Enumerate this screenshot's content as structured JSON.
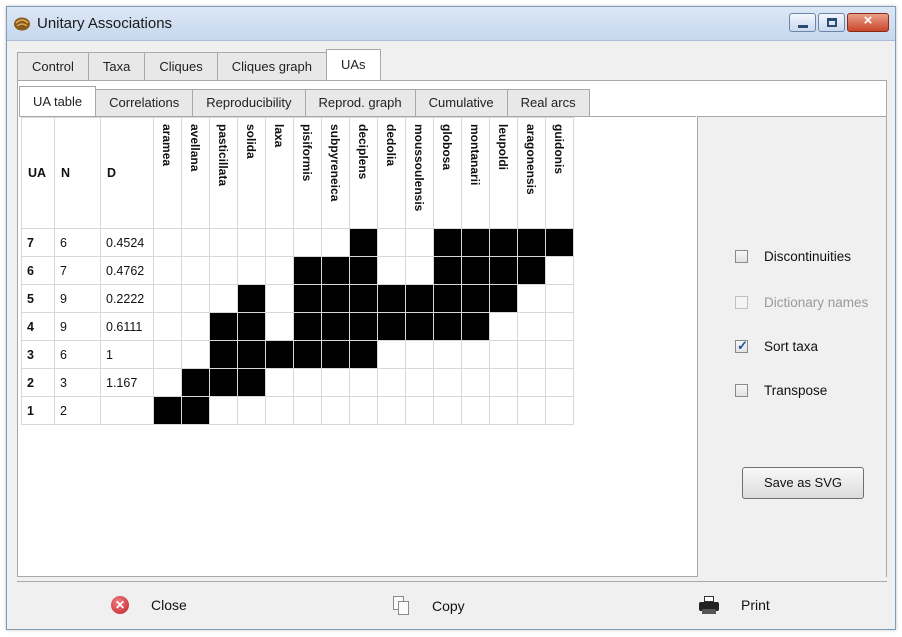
{
  "window": {
    "title": "Unitary Associations",
    "icon": "walnut-app-icon"
  },
  "tabs_main": [
    "Control",
    "Taxa",
    "Cliques",
    "Cliques graph",
    "UAs"
  ],
  "tabs_main_active": 4,
  "tabs_sub": [
    "UA table",
    "Correlations",
    "Reproducibility",
    "Reprod. graph",
    "Cumulative",
    "Real arcs"
  ],
  "tabs_sub_active": 0,
  "table": {
    "headers": {
      "ua": "UA",
      "n": "N",
      "d": "D"
    },
    "taxa": [
      "aramea",
      "avellana",
      "pasticillata",
      "solida",
      "laxa",
      "pisiformis",
      "subpyreneica",
      "deciplens",
      "dedolia",
      "moussoulensis",
      "globosa",
      "montanarii",
      "leupoldi",
      "aragonensis",
      "guidonis"
    ],
    "rows": [
      {
        "ua": "7",
        "n": "6",
        "d": "0.4524",
        "cells": [
          0,
          0,
          0,
          0,
          0,
          0,
          0,
          1,
          0,
          0,
          1,
          1,
          1,
          1,
          1
        ]
      },
      {
        "ua": "6",
        "n": "7",
        "d": "0.4762",
        "cells": [
          0,
          0,
          0,
          0,
          0,
          1,
          1,
          1,
          0,
          0,
          1,
          1,
          1,
          1,
          0
        ]
      },
      {
        "ua": "5",
        "n": "9",
        "d": "0.2222",
        "cells": [
          0,
          0,
          0,
          1,
          0,
          1,
          1,
          1,
          1,
          1,
          1,
          1,
          1,
          0,
          0
        ]
      },
      {
        "ua": "4",
        "n": "9",
        "d": "0.6111",
        "cells": [
          0,
          0,
          1,
          1,
          0,
          1,
          1,
          1,
          1,
          1,
          1,
          1,
          0,
          0,
          0
        ]
      },
      {
        "ua": "3",
        "n": "6",
        "d": "1",
        "cells": [
          0,
          0,
          1,
          1,
          1,
          1,
          1,
          1,
          0,
          0,
          0,
          0,
          0,
          0,
          0
        ]
      },
      {
        "ua": "2",
        "n": "3",
        "d": "1.167",
        "cells": [
          0,
          1,
          1,
          1,
          0,
          0,
          0,
          0,
          0,
          0,
          0,
          0,
          0,
          0,
          0
        ]
      },
      {
        "ua": "1",
        "n": "2",
        "d": "",
        "cells": [
          1,
          1,
          0,
          0,
          0,
          0,
          0,
          0,
          0,
          0,
          0,
          0,
          0,
          0,
          0
        ]
      }
    ]
  },
  "options": {
    "discontinuities": {
      "label": "Discontinuities",
      "checked": false,
      "enabled": true
    },
    "dictionary_names": {
      "label": "Dictionary names",
      "checked": false,
      "enabled": false
    },
    "sort_taxa": {
      "label": "Sort taxa",
      "checked": true,
      "enabled": true
    },
    "transpose": {
      "label": "Transpose",
      "checked": false,
      "enabled": true
    }
  },
  "save_svg_label": "Save as SVG",
  "bottom": {
    "close_label": "Close",
    "copy_label": "Copy",
    "print_label": "Print"
  },
  "colors": {
    "cell_on": "#000000",
    "accent": "#1f4fa0"
  }
}
